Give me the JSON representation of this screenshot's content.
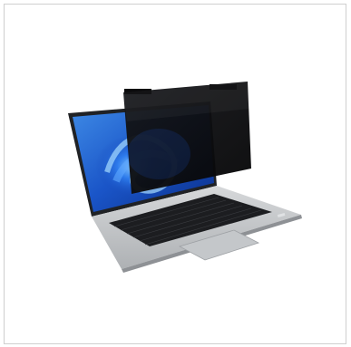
{
  "product": {
    "subject": "laptop-with-privacy-filter",
    "colors": {
      "chassis": "#c9cbcd",
      "keyboard": "#1c1d20",
      "filter": "#0d0e10",
      "wallpaper": "#1a55c8"
    }
  }
}
